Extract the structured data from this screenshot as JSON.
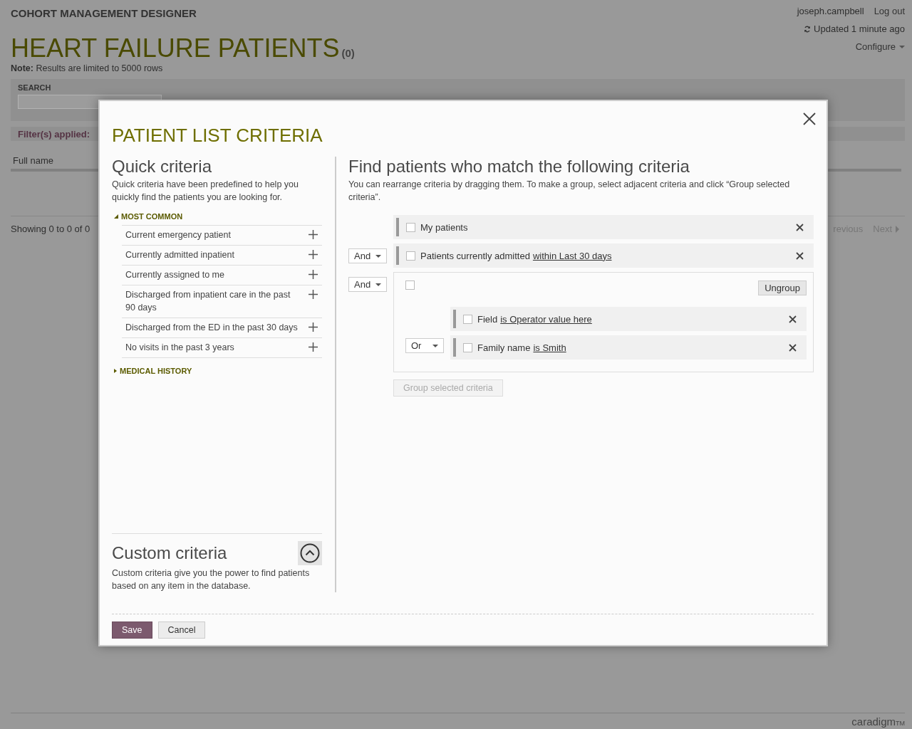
{
  "app": {
    "title": "COHORT MANAGEMENT DESIGNER",
    "user": "joseph.campbell",
    "logout": "Log out",
    "updated": "Updated 1 minute ago",
    "configure": "Configure"
  },
  "page": {
    "title": "HEART FAILURE PATIENTS",
    "count": "(0)",
    "note": "**Note:** Results are limited to 5000 rows",
    "search_label": "SEARCH",
    "filters_label": "Filter(s) applied:",
    "column": "Full name",
    "showing": "Showing 0 to 0 of 0",
    "previous": "revious",
    "next": "Next"
  },
  "dialog": {
    "title": "PATIENT LIST CRITERIA",
    "quick": {
      "title": "Quick criteria",
      "text": "Quick criteria have been predefined to help you quickly find the patients you are looking for.",
      "sections": [
        {
          "title": "MOST COMMON",
          "expanded": true,
          "items": [
            "Current emergency patient",
            "Currently admitted inpatient",
            "Currently assigned to me",
            "Discharged from inpatient care in the past 90 days",
            "Discharged from the ED in the past 30 days",
            "No visits in the past 3 years"
          ]
        },
        {
          "title": "MEDICAL HISTORY",
          "expanded": false
        }
      ]
    },
    "custom": {
      "title": "Custom criteria",
      "text": "Custom criteria give you the power to find patients based on any item in the database."
    },
    "find": {
      "title": "Find patients who match the following criteria",
      "text": "You can rearrange criteria by dragging them. To make a group, select adjacent criteria and click “Group selected criteria”.",
      "criteria": [
        {
          "kind": "criterion",
          "checked": false,
          "text": "My patients"
        },
        {
          "kind": "criterion",
          "connector": "And",
          "checked": false,
          "text": "Patients currently admitted",
          "link": "within Last 30 days"
        },
        {
          "kind": "group",
          "connector": "And",
          "checked": false,
          "ungroup": "Ungroup",
          "children": [
            {
              "kind": "criterion",
              "checked": false,
              "text": "Field",
              "link": "is Operator value here"
            },
            {
              "kind": "criterion",
              "connector": "Or",
              "checked": false,
              "text": "Family name",
              "link": "is Smith"
            }
          ]
        }
      ],
      "group_button": {
        "label": "Group selected criteria",
        "disabled": true
      }
    },
    "buttons": [
      {
        "label": "Save",
        "kind": "primary"
      },
      {
        "label": "Cancel",
        "kind": "secondary"
      }
    ]
  },
  "footer": {
    "brand": "caradigm",
    "mark": "TM"
  }
}
